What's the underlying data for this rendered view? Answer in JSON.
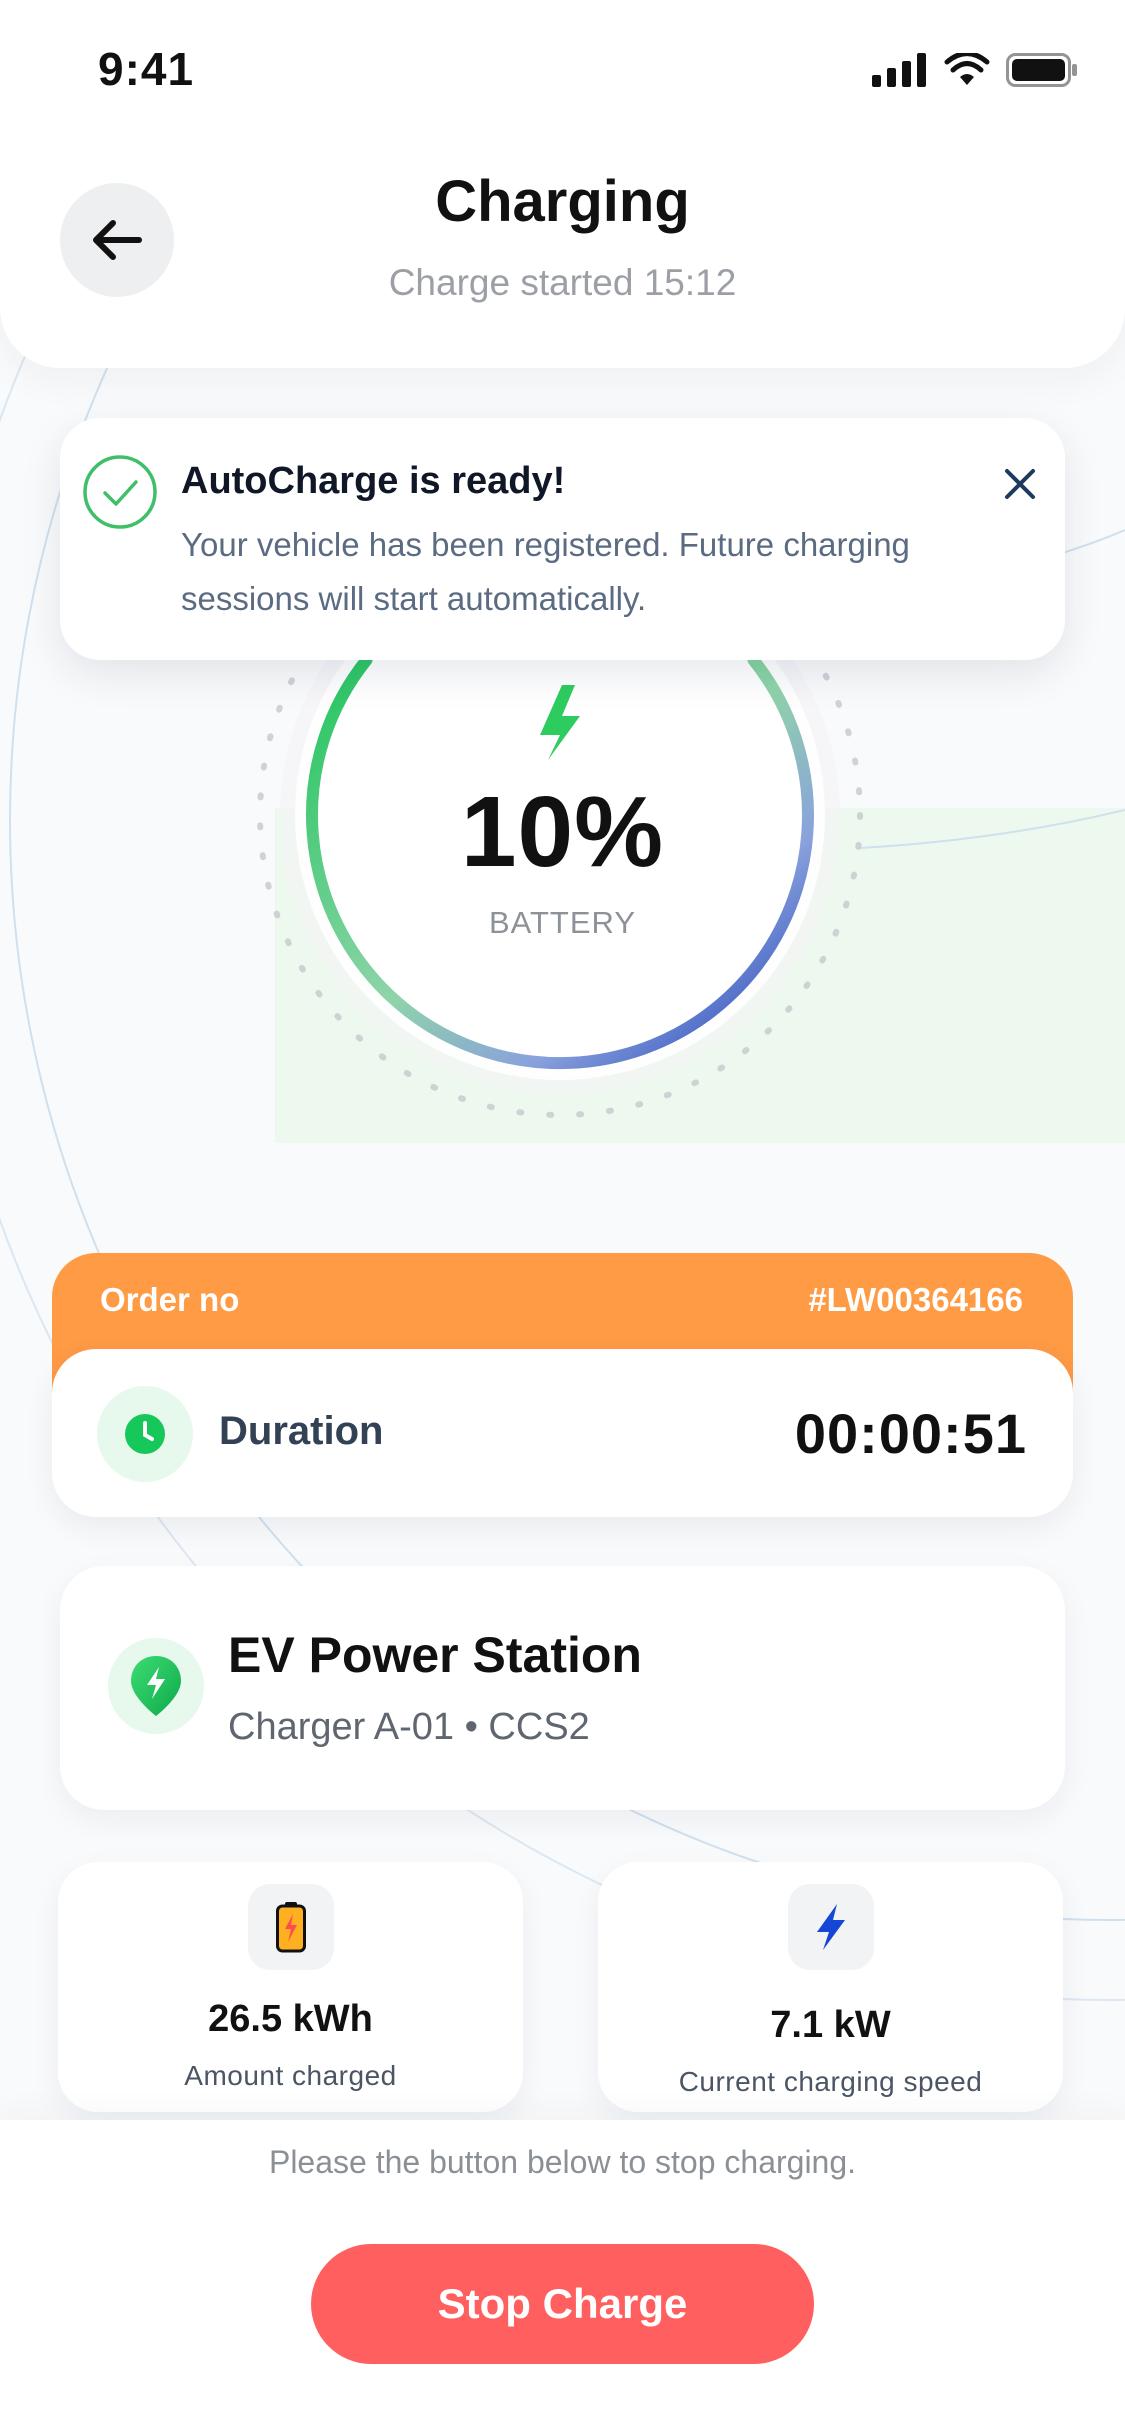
{
  "status_bar": {
    "time": "9:41"
  },
  "header": {
    "title": "Charging",
    "subtitle": "Charge started 15:12"
  },
  "notice": {
    "title": "AutoCharge is ready!",
    "text": "Your vehicle has been registered. Future charging sessions will start automatically."
  },
  "battery": {
    "percent_text": "10%",
    "percent_value": 10,
    "label": "BATTERY"
  },
  "order": {
    "label": "Order no",
    "number": "#LW00364166",
    "duration_label": "Duration",
    "duration_value": "00:00:51"
  },
  "station": {
    "name": "EV Power Station",
    "detail": "Charger A-01 • CCS2"
  },
  "stats": {
    "energy": {
      "value": "26.5 kWh",
      "caption": "Amount charged",
      "icon": "battery-charging-icon"
    },
    "speed": {
      "value": "7.1 kW",
      "caption": "Current charging speed",
      "icon": "lightning-icon"
    }
  },
  "footer": {
    "hint": "Please the button below to stop charging.",
    "stop_label": "Stop Charge"
  },
  "colors": {
    "accent_orange": "#ff9a45",
    "accent_green": "#22c55e",
    "accent_blue": "#1d3fbf",
    "danger": "#ff5f5f"
  }
}
